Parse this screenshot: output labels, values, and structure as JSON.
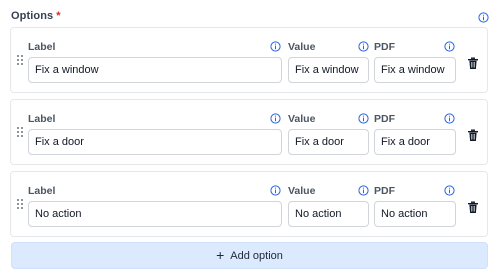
{
  "section": {
    "title": "Options",
    "required_marker": "*"
  },
  "columns": {
    "label": "Label",
    "value": "Value",
    "pdf": "PDF"
  },
  "options": [
    {
      "label": "Fix a window",
      "value": "Fix a window",
      "pdf": "Fix a window"
    },
    {
      "label": "Fix a door",
      "value": "Fix a door",
      "pdf": "Fix a door"
    },
    {
      "label": "No action",
      "value": "No action",
      "pdf": "No action"
    }
  ],
  "add_option": {
    "icon": "plus-icon",
    "label": "Add option"
  },
  "icons": {
    "info": "info-icon",
    "drag": "drag-handle-icon",
    "delete": "trash-icon"
  },
  "colors": {
    "required": "#dc2626",
    "info_icon": "#2563eb",
    "add_button_bg": "#dbeafe",
    "card_border": "#e5e7eb",
    "input_border": "#d1d5db"
  }
}
